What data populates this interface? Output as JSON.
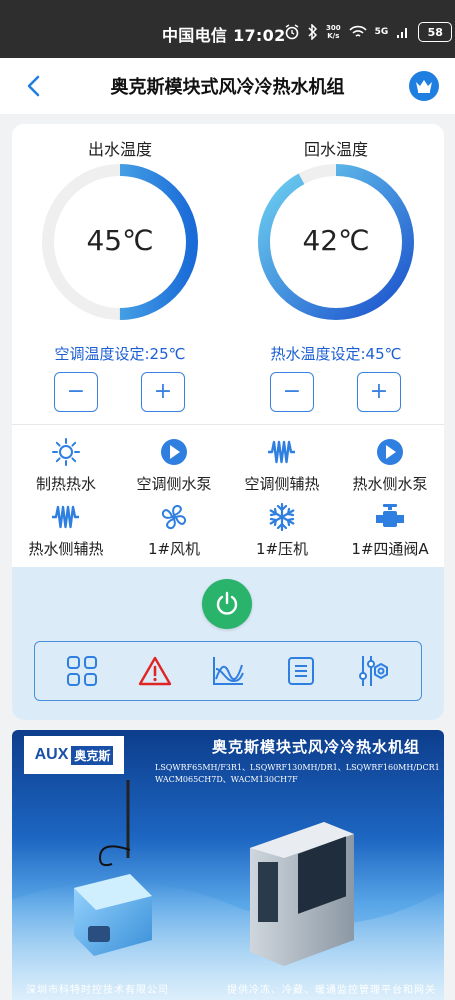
{
  "status_bar": {
    "time": "中国电信 17:02",
    "speed_top": "300",
    "speed_bottom": "K/s",
    "signal": "5G",
    "battery": "58"
  },
  "header": {
    "title": "奥克斯模块式风冷冷热水机组"
  },
  "gauges": [
    {
      "title": "出水温度",
      "value": "45℃",
      "fill_fraction": 0.5,
      "colors": [
        "#6fd3f0",
        "#1a6bd8"
      ]
    },
    {
      "title": "回水温度",
      "value": "42℃",
      "fill_fraction": 0.92,
      "colors": [
        "#6fd3f0",
        "#1a4fcc"
      ]
    }
  ],
  "setpoints": [
    {
      "label": "空调温度设定:25℃",
      "minus": "−",
      "plus": "+"
    },
    {
      "label": "热水温度设定:45℃",
      "minus": "−",
      "plus": "+"
    }
  ],
  "functions": [
    {
      "label": "制热热水",
      "icon": "sun-icon"
    },
    {
      "label": "空调侧水泵",
      "icon": "pump-icon"
    },
    {
      "label": "空调侧辅热",
      "icon": "heater-icon"
    },
    {
      "label": "热水侧水泵",
      "icon": "pump-icon"
    },
    {
      "label": "热水侧辅热",
      "icon": "heater-icon"
    },
    {
      "label": "1#风机",
      "icon": "fan-icon"
    },
    {
      "label": "1#压机",
      "icon": "snowflake-icon"
    },
    {
      "label": "1#四通阀A",
      "icon": "valve-icon"
    }
  ],
  "toolbar": [
    "grid-icon",
    "alarm-icon",
    "chart-icon",
    "list-icon",
    "settings-sliders-icon"
  ],
  "banner": {
    "logo_text": "AUX",
    "logo_cn": "奥克斯",
    "title": "奥克斯模块式风冷冷热水机组",
    "models_line1": "LSQWRF65MH/F3R1、LSQWRF130MH/DR1、LSQWRF160MH/DCR1",
    "models_line2": "WACM065CH7D、WACM130CH7F",
    "footer_left": "深圳市科特时控技术有限公司",
    "footer_right": "提供冷冻、冷藏、暖通监控管理平台和网关"
  },
  "colors": {
    "accent": "#3b82e0",
    "setpoint_text": "#1c5fd4",
    "power": "#29b36b",
    "panel_bg": "#dcebf8"
  }
}
